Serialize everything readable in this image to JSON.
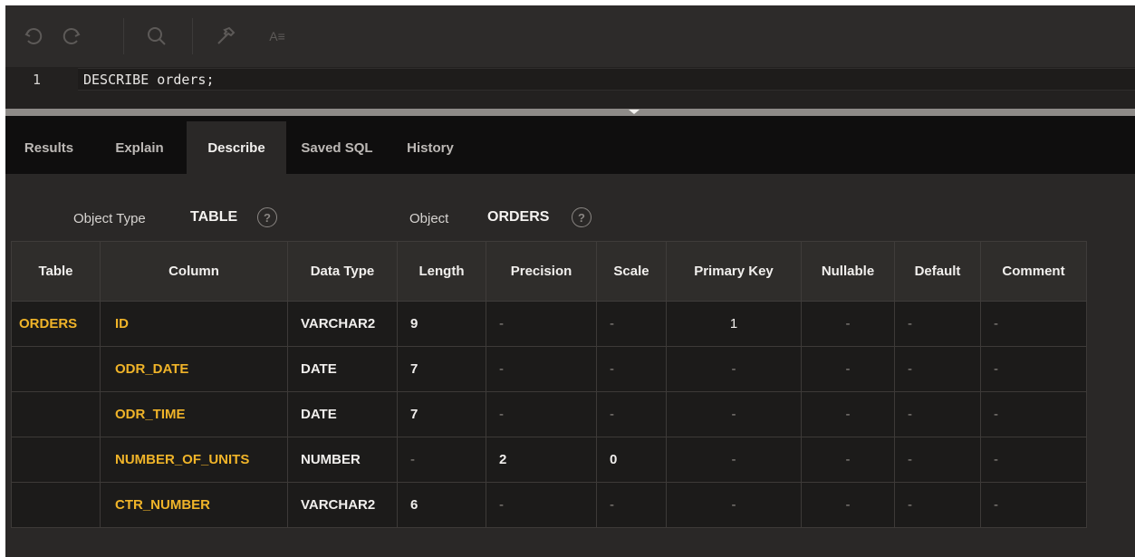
{
  "toolbar": {
    "icons": [
      "undo-icon",
      "redo-icon",
      "search-icon",
      "hammer-icon",
      "format-icon"
    ],
    "format_label": "A≡"
  },
  "editor": {
    "line_number": "1",
    "code": "DESCRIBE orders;"
  },
  "tabs": [
    {
      "label": "Results",
      "active": false
    },
    {
      "label": "Explain",
      "active": false
    },
    {
      "label": "Describe",
      "active": true
    },
    {
      "label": "Saved SQL",
      "active": false
    },
    {
      "label": "History",
      "active": false
    }
  ],
  "object_info": {
    "object_type_label": "Object Type",
    "object_type_value": "TABLE",
    "object_label": "Object",
    "object_value": "ORDERS",
    "help_glyph": "?"
  },
  "describe_table": {
    "columns": [
      "Table",
      "Column",
      "Data Type",
      "Length",
      "Precision",
      "Scale",
      "Primary Key",
      "Nullable",
      "Default",
      "Comment"
    ],
    "rows": [
      [
        "ORDERS",
        "ID",
        "VARCHAR2",
        "9",
        "-",
        "-",
        "1",
        "-",
        "-",
        "-"
      ],
      [
        "",
        "ODR_DATE",
        "DATE",
        "7",
        "-",
        "-",
        "-",
        "-",
        "-",
        "-"
      ],
      [
        "",
        "ODR_TIME",
        "DATE",
        "7",
        "-",
        "-",
        "-",
        "-",
        "-",
        "-"
      ],
      [
        "",
        "NUMBER_OF_UNITS",
        "NUMBER",
        "-",
        "2",
        "0",
        "-",
        "-",
        "-",
        "-"
      ],
      [
        "",
        "CTR_NUMBER",
        "VARCHAR2",
        "6",
        "-",
        "-",
        "-",
        "-",
        "-",
        "-"
      ]
    ]
  },
  "colors": {
    "accent_yellow": "#f0b429",
    "background": "#2a2827",
    "tab_bar": "#0f0e0e"
  }
}
